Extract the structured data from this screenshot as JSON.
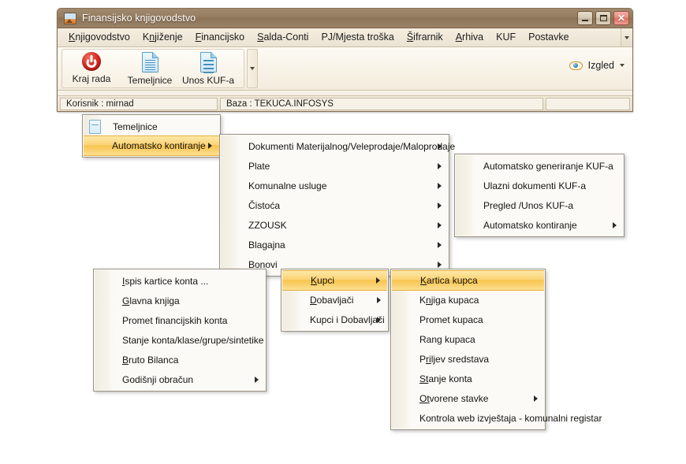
{
  "window": {
    "title": "Finansijsko knjigovodstvo",
    "icon": "chart-window-icon",
    "controls": {
      "minimize": "minimize-icon",
      "maximize": "maximize-icon",
      "close": "close-icon"
    }
  },
  "menubar": {
    "items": [
      {
        "label": "Knjigovodstvo",
        "mnemonic": "K"
      },
      {
        "label": "Knjiženje",
        "mnemonic": "n"
      },
      {
        "label": "Financijsko",
        "mnemonic": "F"
      },
      {
        "label": "Salda-Conti",
        "mnemonic": "S"
      },
      {
        "label": "PJ/Mjesta troška",
        "mnemonic": ""
      },
      {
        "label": "Šifrarnik",
        "mnemonic": "Š"
      },
      {
        "label": "Arhiva",
        "mnemonic": "A"
      },
      {
        "label": "KUF",
        "mnemonic": ""
      },
      {
        "label": "Postavke",
        "mnemonic": ""
      }
    ],
    "overflow_icon": "chevron-down-icon"
  },
  "ribbon": {
    "buttons": [
      {
        "label": "Kraj rada",
        "icon": "power-icon"
      },
      {
        "label": "Temeljnice",
        "icon": "document-icon"
      },
      {
        "label": "Unos KUF-a",
        "icon": "document-icon"
      }
    ],
    "more_icon": "chevron-down-icon",
    "view": {
      "label": "Izgled",
      "icon": "eye-icon",
      "caret": "chevron-down-icon"
    }
  },
  "statusbar": {
    "user": "Korisnik : mirnad",
    "database": "Baza : TEKUCA.INFOSYS",
    "extra": ""
  },
  "menus": {
    "knjigovodstvo": [
      {
        "label": "Temeljnice",
        "icon": "document-icon",
        "arrow": false,
        "selected": false
      },
      {
        "label": "Automatsko kontiranje",
        "icon": null,
        "arrow": true,
        "selected": true
      }
    ],
    "automatsko_kontiranje": [
      {
        "label": "Dokumenti Materijalnog/Veleprodaje/Maloprodaje",
        "arrow": true,
        "selected": false
      },
      {
        "label": "Plate",
        "arrow": true,
        "selected": false
      },
      {
        "label": "Komunalne usluge",
        "arrow": true,
        "selected": false
      },
      {
        "label": "Čistoća",
        "arrow": true,
        "selected": false
      },
      {
        "label": "ZZOUSK",
        "arrow": true,
        "selected": false
      },
      {
        "label": "Blagajna",
        "arrow": true,
        "selected": false
      },
      {
        "label": "Bonovi",
        "arrow": true,
        "selected": false
      }
    ],
    "kuf": [
      {
        "label": "Automatsko generiranje KUF-a",
        "arrow": false,
        "selected": false
      },
      {
        "label": "Ulazni dokumenti KUF-a",
        "arrow": false,
        "selected": false
      },
      {
        "label": "Pregled /Unos KUF-a",
        "arrow": false,
        "selected": false
      },
      {
        "label": "Automatsko kontiranje",
        "arrow": true,
        "selected": false
      }
    ],
    "financijsko": [
      {
        "label": "Ispis kartice konta ...",
        "mnemonic": "I",
        "arrow": false,
        "selected": false
      },
      {
        "label": "Glavna knjiga",
        "mnemonic": "G",
        "arrow": false,
        "selected": false
      },
      {
        "label": "Promet financijskih konta",
        "mnemonic": "",
        "arrow": false,
        "selected": false
      },
      {
        "label": "Stanje konta/klase/grupe/sintetike",
        "mnemonic": "",
        "arrow": false,
        "selected": false
      },
      {
        "label": "Bruto Bilanca",
        "mnemonic": "B",
        "arrow": false,
        "selected": false
      },
      {
        "label": "Godišnji obračun",
        "mnemonic": "",
        "arrow": true,
        "selected": false
      }
    ],
    "salda_conti": [
      {
        "label": "Kupci",
        "mnemonic": "K",
        "arrow": true,
        "selected": true
      },
      {
        "label": "Dobavljači",
        "mnemonic": "D",
        "arrow": true,
        "selected": false
      },
      {
        "label": "Kupci i Dobavljači",
        "mnemonic": "",
        "arrow": true,
        "selected": false
      }
    ],
    "kupci": [
      {
        "label": "Kartica kupca",
        "mnemonic": "K",
        "arrow": false,
        "selected": true
      },
      {
        "label": "Knjiga kupaca",
        "mnemonic": "n",
        "arrow": false,
        "selected": false
      },
      {
        "label": "Promet kupaca",
        "mnemonic": "",
        "arrow": false,
        "selected": false
      },
      {
        "label": "Rang kupaca",
        "mnemonic": "g",
        "arrow": false,
        "selected": false
      },
      {
        "label": "Priljev sredstava",
        "mnemonic": "ri",
        "arrow": false,
        "selected": false
      },
      {
        "label": "Stanje konta",
        "mnemonic": "St",
        "arrow": false,
        "selected": false
      },
      {
        "label": "Otvorene stavke",
        "mnemonic": "Ot",
        "arrow": true,
        "selected": false
      },
      {
        "label": "Kontrola web izvještaja - komunalni registar",
        "mnemonic": "",
        "arrow": false,
        "selected": false
      }
    ]
  },
  "colors": {
    "titlebar": "#957d60",
    "highlight": "#f8c44e",
    "menu_bg": "#fbfaf7",
    "window_bg": "#f6f1e6",
    "accent_doc": "#5b9dc4"
  }
}
